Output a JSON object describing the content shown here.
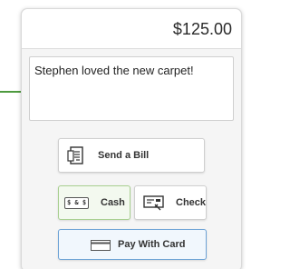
{
  "amount": "$125.00",
  "note": {
    "text": "Stephen loved the new carpet!"
  },
  "buttons": {
    "send_bill": "Send a Bill",
    "cash": "Cash",
    "cash_icon_text": "$ & $",
    "check": "Check",
    "card": "Pay With Card"
  },
  "icons": {
    "send_bill": "bill-document-icon",
    "cash": "cash-bill-icon",
    "check": "check-icon",
    "card": "credit-card-icon"
  },
  "colors": {
    "callout": "#57a846",
    "cash_selected_border": "#a8cf90",
    "card_border": "#6da3d6"
  }
}
